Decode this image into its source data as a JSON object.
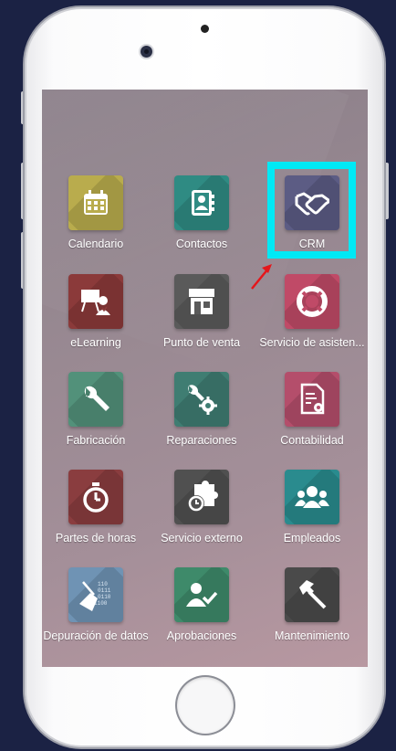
{
  "screen": {
    "apps": [
      {
        "label": "Calendario",
        "icon": "calendar-icon",
        "color": "#b9ac4d"
      },
      {
        "label": "Contactos",
        "icon": "contact-book-icon",
        "color": "#2f8b83"
      },
      {
        "label": "CRM",
        "icon": "handshake-icon",
        "color": "#5c5c84"
      },
      {
        "label": "eLearning",
        "icon": "teacher-board-icon",
        "color": "#8b3a3a"
      },
      {
        "label": "Punto de venta",
        "icon": "store-icon",
        "color": "#5a5a5a"
      },
      {
        "label": "Servicio de asisten...",
        "icon": "life-ring-icon",
        "color": "#c04a67"
      },
      {
        "label": "Fabricación",
        "icon": "wrench-icon",
        "color": "#52917a"
      },
      {
        "label": "Reparaciones",
        "icon": "wrench-gear-icon",
        "color": "#3f7d72"
      },
      {
        "label": "Contabilidad",
        "icon": "invoice-gear-icon",
        "color": "#b44e6b"
      },
      {
        "label": "Partes de horas",
        "icon": "stopwatch-icon",
        "color": "#8a3d3f"
      },
      {
        "label": "Servicio externo",
        "icon": "puzzle-clock-icon",
        "color": "#505050"
      },
      {
        "label": "Empleados",
        "icon": "users-icon",
        "color": "#2a8b8e"
      },
      {
        "label": "Depuración de datos",
        "icon": "broom-binary-icon",
        "color": "#6f93b4"
      },
      {
        "label": "Aprobaciones",
        "icon": "user-check-icon",
        "color": "#3e8a6a"
      },
      {
        "label": "Mantenimiento",
        "icon": "hammer-icon",
        "color": "#4a4a4a"
      }
    ]
  },
  "highlight": {
    "target": "CRM",
    "color": "#00e9f5"
  },
  "pointer_arrow": {
    "color": "#e5161b"
  }
}
